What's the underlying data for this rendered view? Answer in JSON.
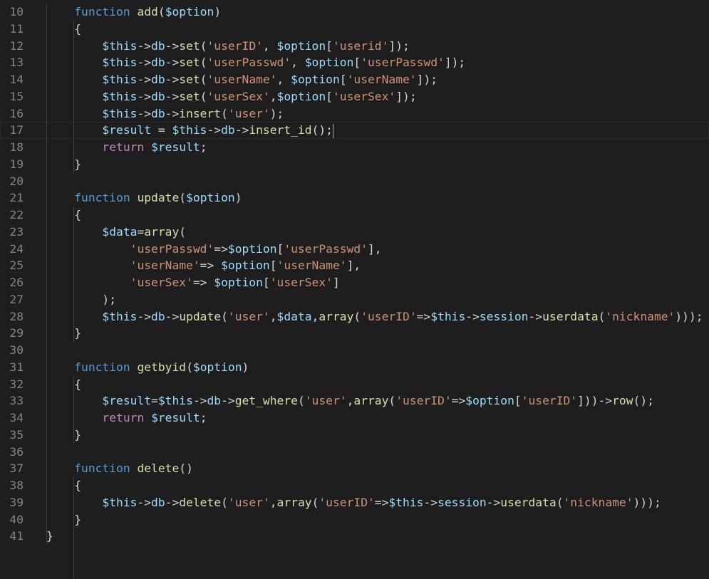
{
  "editor": {
    "theme_colors": {
      "background": "#1e1e1e",
      "line_number": "#858585",
      "keyword": "#569cd6",
      "variable": "#9cdcfe",
      "function": "#dcdcaa",
      "string": "#ce9178",
      "control": "#c586c0",
      "plain": "#d4d4d4"
    },
    "current_line": 17,
    "lines": [
      {
        "n": "10",
        "tokens": [
          [
            "pun",
            "    "
          ],
          [
            "kw",
            "function"
          ],
          [
            "pun",
            " "
          ],
          [
            "fn",
            "add"
          ],
          [
            "pun",
            "("
          ],
          [
            "var",
            "$option"
          ],
          [
            "pun",
            ")"
          ]
        ]
      },
      {
        "n": "11",
        "tokens": [
          [
            "pun",
            "    {"
          ]
        ]
      },
      {
        "n": "12",
        "tokens": [
          [
            "pun",
            "        "
          ],
          [
            "var",
            "$this"
          ],
          [
            "pun",
            "->"
          ],
          [
            "var",
            "db"
          ],
          [
            "pun",
            "->"
          ],
          [
            "fn",
            "set"
          ],
          [
            "pun",
            "("
          ],
          [
            "str",
            "'userID'"
          ],
          [
            "pun",
            ", "
          ],
          [
            "var",
            "$option"
          ],
          [
            "pun",
            "["
          ],
          [
            "str",
            "'userid'"
          ],
          [
            "pun",
            "]);"
          ]
        ]
      },
      {
        "n": "13",
        "tokens": [
          [
            "pun",
            "        "
          ],
          [
            "var",
            "$this"
          ],
          [
            "pun",
            "->"
          ],
          [
            "var",
            "db"
          ],
          [
            "pun",
            "->"
          ],
          [
            "fn",
            "set"
          ],
          [
            "pun",
            "("
          ],
          [
            "str",
            "'userPasswd'"
          ],
          [
            "pun",
            ", "
          ],
          [
            "var",
            "$option"
          ],
          [
            "pun",
            "["
          ],
          [
            "str",
            "'userPasswd'"
          ],
          [
            "pun",
            "]);"
          ]
        ]
      },
      {
        "n": "14",
        "tokens": [
          [
            "pun",
            "        "
          ],
          [
            "var",
            "$this"
          ],
          [
            "pun",
            "->"
          ],
          [
            "var",
            "db"
          ],
          [
            "pun",
            "->"
          ],
          [
            "fn",
            "set"
          ],
          [
            "pun",
            "("
          ],
          [
            "str",
            "'userName'"
          ],
          [
            "pun",
            ", "
          ],
          [
            "var",
            "$option"
          ],
          [
            "pun",
            "["
          ],
          [
            "str",
            "'userName'"
          ],
          [
            "pun",
            "]);"
          ]
        ]
      },
      {
        "n": "15",
        "tokens": [
          [
            "pun",
            "        "
          ],
          [
            "var",
            "$this"
          ],
          [
            "pun",
            "->"
          ],
          [
            "var",
            "db"
          ],
          [
            "pun",
            "->"
          ],
          [
            "fn",
            "set"
          ],
          [
            "pun",
            "("
          ],
          [
            "str",
            "'userSex'"
          ],
          [
            "pun",
            ","
          ],
          [
            "var",
            "$option"
          ],
          [
            "pun",
            "["
          ],
          [
            "str",
            "'userSex'"
          ],
          [
            "pun",
            "]);"
          ]
        ]
      },
      {
        "n": "16",
        "tokens": [
          [
            "pun",
            "        "
          ],
          [
            "var",
            "$this"
          ],
          [
            "pun",
            "->"
          ],
          [
            "var",
            "db"
          ],
          [
            "pun",
            "->"
          ],
          [
            "fn",
            "insert"
          ],
          [
            "pun",
            "("
          ],
          [
            "str",
            "'user'"
          ],
          [
            "pun",
            ");"
          ]
        ]
      },
      {
        "n": "17",
        "tokens": [
          [
            "pun",
            "        "
          ],
          [
            "var",
            "$result"
          ],
          [
            "pun",
            " = "
          ],
          [
            "var",
            "$this"
          ],
          [
            "pun",
            "->"
          ],
          [
            "var",
            "db"
          ],
          [
            "pun",
            "->"
          ],
          [
            "fn",
            "insert_id"
          ],
          [
            "pun",
            "();"
          ]
        ]
      },
      {
        "n": "18",
        "tokens": [
          [
            "pun",
            "        "
          ],
          [
            "ctl",
            "return"
          ],
          [
            "pun",
            " "
          ],
          [
            "var",
            "$result"
          ],
          [
            "pun",
            ";"
          ]
        ]
      },
      {
        "n": "19",
        "tokens": [
          [
            "pun",
            "    }"
          ]
        ]
      },
      {
        "n": "20",
        "tokens": []
      },
      {
        "n": "21",
        "tokens": [
          [
            "pun",
            "    "
          ],
          [
            "kw",
            "function"
          ],
          [
            "pun",
            " "
          ],
          [
            "fn",
            "update"
          ],
          [
            "pun",
            "("
          ],
          [
            "var",
            "$option"
          ],
          [
            "pun",
            ")"
          ]
        ]
      },
      {
        "n": "22",
        "tokens": [
          [
            "pun",
            "    {"
          ]
        ]
      },
      {
        "n": "23",
        "tokens": [
          [
            "pun",
            "        "
          ],
          [
            "var",
            "$data"
          ],
          [
            "pun",
            "="
          ],
          [
            "fn",
            "array"
          ],
          [
            "pun",
            "("
          ]
        ]
      },
      {
        "n": "24",
        "tokens": [
          [
            "pun",
            "            "
          ],
          [
            "str",
            "'userPasswd'"
          ],
          [
            "pun",
            "=>"
          ],
          [
            "var",
            "$option"
          ],
          [
            "pun",
            "["
          ],
          [
            "str",
            "'userPasswd'"
          ],
          [
            "pun",
            "],"
          ]
        ]
      },
      {
        "n": "25",
        "tokens": [
          [
            "pun",
            "            "
          ],
          [
            "str",
            "'userName'"
          ],
          [
            "pun",
            "=> "
          ],
          [
            "var",
            "$option"
          ],
          [
            "pun",
            "["
          ],
          [
            "str",
            "'userName'"
          ],
          [
            "pun",
            "],"
          ]
        ]
      },
      {
        "n": "26",
        "tokens": [
          [
            "pun",
            "            "
          ],
          [
            "str",
            "'userSex'"
          ],
          [
            "pun",
            "=> "
          ],
          [
            "var",
            "$option"
          ],
          [
            "pun",
            "["
          ],
          [
            "str",
            "'userSex'"
          ],
          [
            "pun",
            "]"
          ]
        ]
      },
      {
        "n": "27",
        "tokens": [
          [
            "pun",
            "        );"
          ]
        ]
      },
      {
        "n": "28",
        "tokens": [
          [
            "pun",
            "        "
          ],
          [
            "var",
            "$this"
          ],
          [
            "pun",
            "->"
          ],
          [
            "var",
            "db"
          ],
          [
            "pun",
            "->"
          ],
          [
            "fn",
            "update"
          ],
          [
            "pun",
            "("
          ],
          [
            "str",
            "'user'"
          ],
          [
            "pun",
            ","
          ],
          [
            "var",
            "$data"
          ],
          [
            "pun",
            ","
          ],
          [
            "fn",
            "array"
          ],
          [
            "pun",
            "("
          ],
          [
            "str",
            "'userID'"
          ],
          [
            "pun",
            "=>"
          ],
          [
            "var",
            "$this"
          ],
          [
            "pun",
            "->"
          ],
          [
            "var",
            "session"
          ],
          [
            "pun",
            "->"
          ],
          [
            "fn",
            "userdata"
          ],
          [
            "pun",
            "("
          ],
          [
            "str",
            "'nickname'"
          ],
          [
            "pun",
            ")));"
          ]
        ]
      },
      {
        "n": "29",
        "tokens": [
          [
            "pun",
            "    }"
          ]
        ]
      },
      {
        "n": "30",
        "tokens": []
      },
      {
        "n": "31",
        "tokens": [
          [
            "pun",
            "    "
          ],
          [
            "kw",
            "function"
          ],
          [
            "pun",
            " "
          ],
          [
            "fn",
            "getbyid"
          ],
          [
            "pun",
            "("
          ],
          [
            "var",
            "$option"
          ],
          [
            "pun",
            ")"
          ]
        ]
      },
      {
        "n": "32",
        "tokens": [
          [
            "pun",
            "    {"
          ]
        ]
      },
      {
        "n": "33",
        "tokens": [
          [
            "pun",
            "        "
          ],
          [
            "var",
            "$result"
          ],
          [
            "pun",
            "="
          ],
          [
            "var",
            "$this"
          ],
          [
            "pun",
            "->"
          ],
          [
            "var",
            "db"
          ],
          [
            "pun",
            "->"
          ],
          [
            "fn",
            "get_where"
          ],
          [
            "pun",
            "("
          ],
          [
            "str",
            "'user'"
          ],
          [
            "pun",
            ","
          ],
          [
            "fn",
            "array"
          ],
          [
            "pun",
            "("
          ],
          [
            "str",
            "'userID'"
          ],
          [
            "pun",
            "=>"
          ],
          [
            "var",
            "$option"
          ],
          [
            "pun",
            "["
          ],
          [
            "str",
            "'userID'"
          ],
          [
            "pun",
            "]))->"
          ],
          [
            "fn",
            "row"
          ],
          [
            "pun",
            "();"
          ]
        ]
      },
      {
        "n": "34",
        "tokens": [
          [
            "pun",
            "        "
          ],
          [
            "ctl",
            "return"
          ],
          [
            "pun",
            " "
          ],
          [
            "var",
            "$result"
          ],
          [
            "pun",
            ";"
          ]
        ]
      },
      {
        "n": "35",
        "tokens": [
          [
            "pun",
            "    }"
          ]
        ]
      },
      {
        "n": "36",
        "tokens": []
      },
      {
        "n": "37",
        "tokens": [
          [
            "pun",
            "    "
          ],
          [
            "kw",
            "function"
          ],
          [
            "pun",
            " "
          ],
          [
            "fn",
            "delete"
          ],
          [
            "pun",
            "()"
          ]
        ]
      },
      {
        "n": "38",
        "tokens": [
          [
            "pun",
            "    {"
          ]
        ]
      },
      {
        "n": "39",
        "tokens": [
          [
            "pun",
            "        "
          ],
          [
            "var",
            "$this"
          ],
          [
            "pun",
            "->"
          ],
          [
            "var",
            "db"
          ],
          [
            "pun",
            "->"
          ],
          [
            "fn",
            "delete"
          ],
          [
            "pun",
            "("
          ],
          [
            "str",
            "'user'"
          ],
          [
            "pun",
            ","
          ],
          [
            "fn",
            "array"
          ],
          [
            "pun",
            "("
          ],
          [
            "str",
            "'userID'"
          ],
          [
            "pun",
            "=>"
          ],
          [
            "var",
            "$this"
          ],
          [
            "pun",
            "->"
          ],
          [
            "var",
            "session"
          ],
          [
            "pun",
            "->"
          ],
          [
            "fn",
            "userdata"
          ],
          [
            "pun",
            "("
          ],
          [
            "str",
            "'nickname'"
          ],
          [
            "pun",
            ")));"
          ]
        ]
      },
      {
        "n": "40",
        "tokens": [
          [
            "pun",
            "    }"
          ]
        ]
      },
      {
        "n": "41",
        "tokens": [
          [
            "pun",
            "}"
          ]
        ]
      }
    ]
  }
}
